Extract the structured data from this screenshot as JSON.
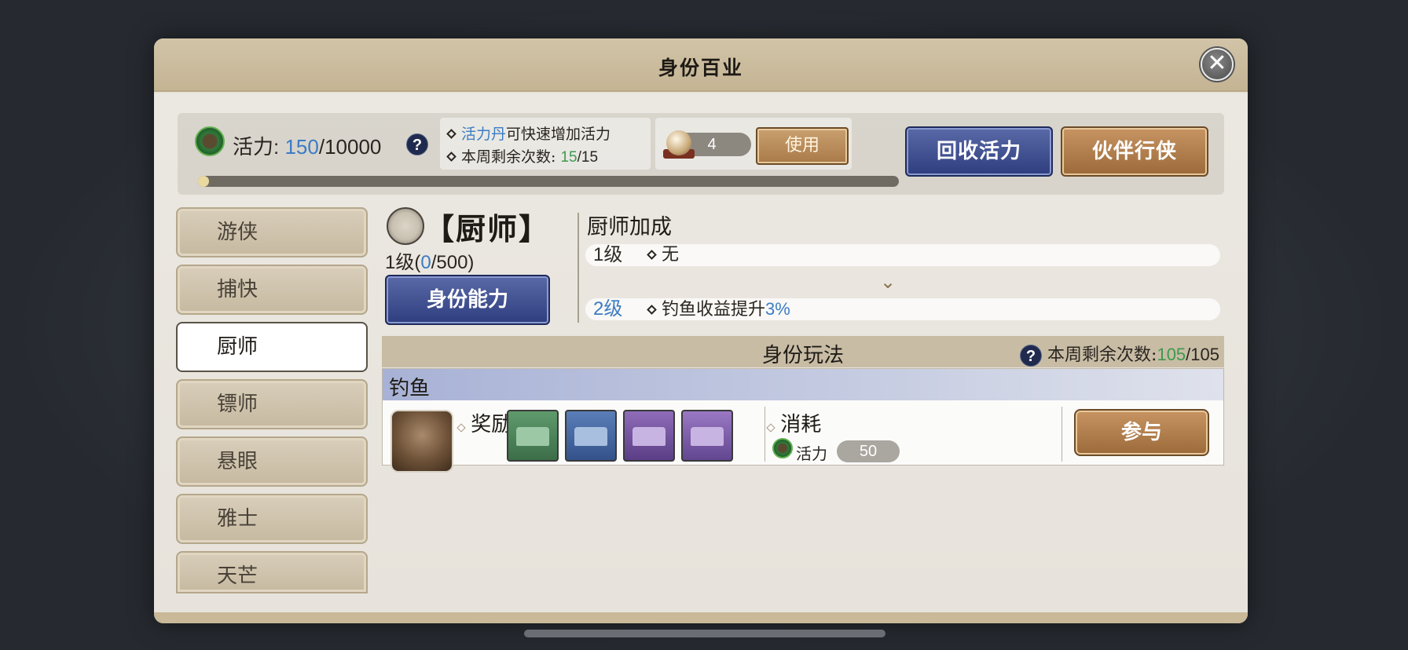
{
  "dialog": {
    "title": "身份百业",
    "close_icon": "close-icon"
  },
  "vigor": {
    "label": "活力:",
    "current": "150",
    "max": "/10000",
    "progress_fraction": 0.015
  },
  "tips": {
    "line1_highlight": "活力丹",
    "line1_rest": "可快速增加活力",
    "line2_label": "本周剩余次数:",
    "line2_current": "15",
    "line2_max": "/15"
  },
  "item": {
    "count": "4",
    "use_label": "使用"
  },
  "buttons": {
    "recycle": "回收活力",
    "partner": "伙伴行侠"
  },
  "sidebar": {
    "items": [
      {
        "label": "游侠"
      },
      {
        "label": "捕快"
      },
      {
        "label": "厨师"
      },
      {
        "label": "镖师"
      },
      {
        "label": "悬眼"
      },
      {
        "label": "雅士"
      },
      {
        "label": "天芒"
      }
    ],
    "active_index": 2
  },
  "profession": {
    "title": "【厨师】",
    "level_prefix": "1级(",
    "exp_current": "0",
    "exp_max": "/500)",
    "ability_button": "身份能力"
  },
  "bonus": {
    "title": "厨师加成",
    "rows": [
      {
        "level": "1级",
        "text": "无",
        "highlight": ""
      },
      {
        "level": "2级",
        "text": "钓鱼收益提升",
        "highlight": "3%"
      }
    ]
  },
  "gameplay": {
    "title": "身份玩法",
    "remain_label": "本周剩余次数:",
    "remain_current": "105",
    "remain_max": "/105",
    "activity": {
      "name": "钓鱼",
      "reward_label": "奖励",
      "cost_label": "消耗",
      "cost_item": "活力",
      "cost_value": "50",
      "join_label": "参与"
    }
  }
}
